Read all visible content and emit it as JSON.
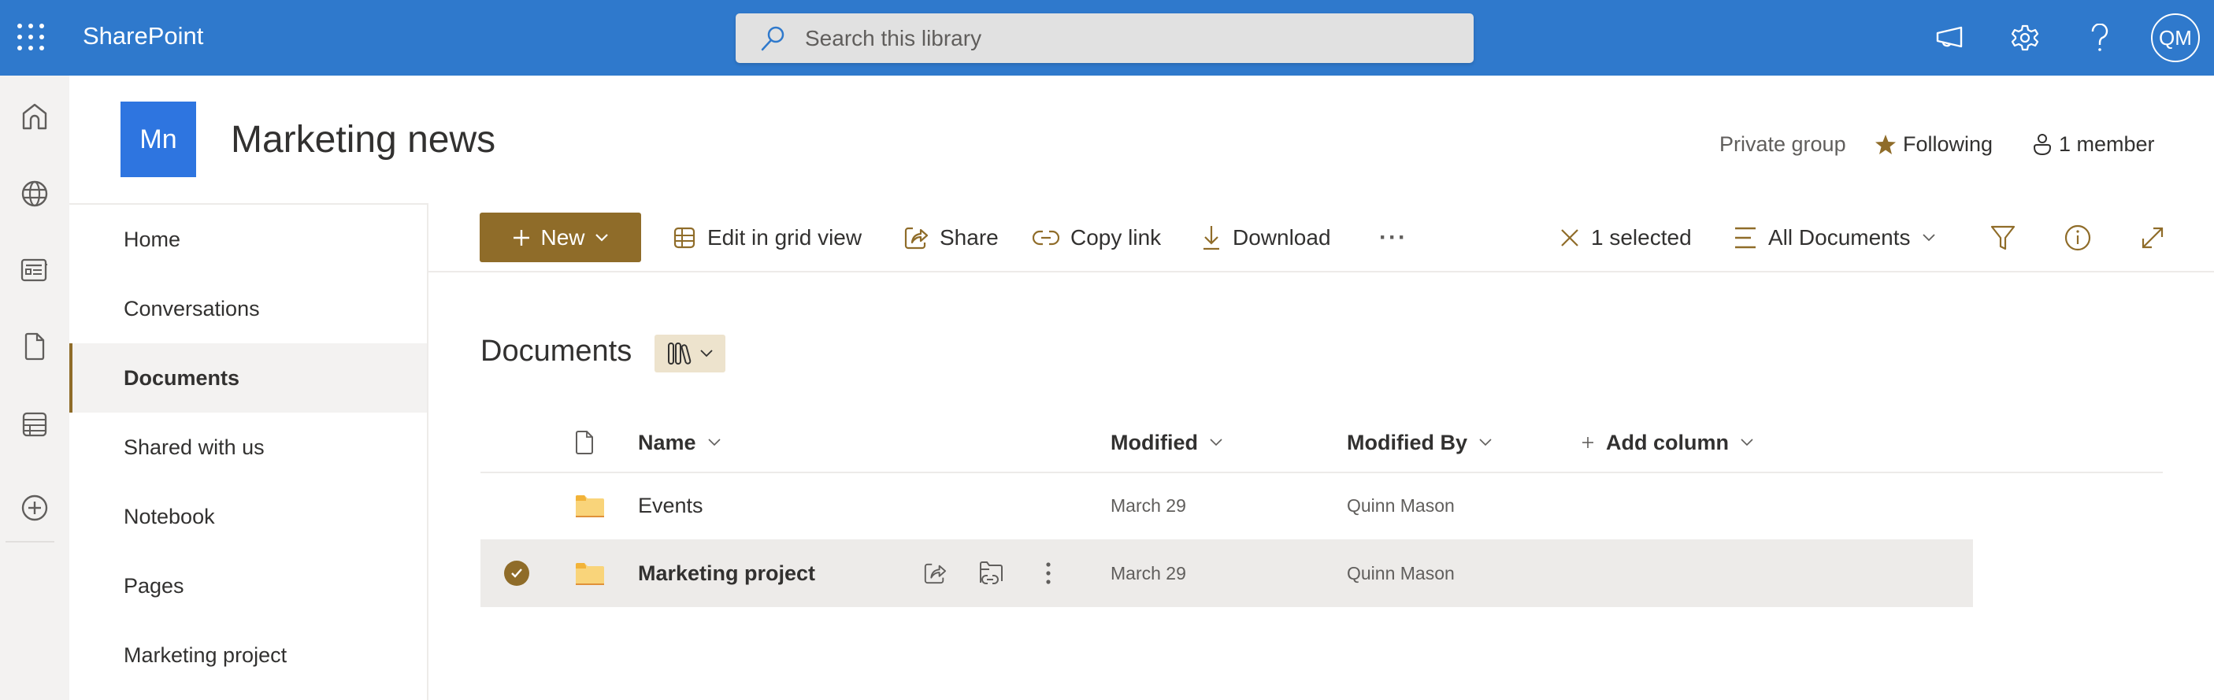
{
  "app": {
    "brand": "SharePoint",
    "search_placeholder": "Search this library",
    "user_initials": "QM",
    "colors": {
      "topbar": "#2F79CC",
      "accent": "#8F6C29",
      "site_logo": "#2E75E0"
    }
  },
  "header_icons": [
    "waffle-icon",
    "megaphone-icon",
    "gear-icon",
    "help-icon"
  ],
  "rail": {
    "items": [
      "home-icon",
      "globe-icon",
      "news-icon",
      "file-icon",
      "list-icon",
      "add-circle-icon"
    ]
  },
  "site": {
    "logo_initials": "Mn",
    "title": "Marketing news",
    "privacy": "Private group",
    "follow_label": "Following",
    "members_label": "1 member"
  },
  "nav": {
    "items": [
      {
        "label": "Home",
        "active": false
      },
      {
        "label": "Conversations",
        "active": false
      },
      {
        "label": "Documents",
        "active": true
      },
      {
        "label": "Shared with us",
        "active": false
      },
      {
        "label": "Notebook",
        "active": false
      },
      {
        "label": "Pages",
        "active": false
      },
      {
        "label": "Marketing project",
        "active": false
      }
    ]
  },
  "toolbar": {
    "new_label": "New",
    "edit_grid_label": "Edit in grid view",
    "share_label": "Share",
    "copy_link_label": "Copy link",
    "download_label": "Download",
    "more_label": "···",
    "selected_label": "1 selected",
    "view_label": "All Documents"
  },
  "library": {
    "title": "Documents",
    "columns": {
      "name": "Name",
      "modified": "Modified",
      "modified_by": "Modified By",
      "add_column": "Add column"
    },
    "rows": [
      {
        "name": "Events",
        "type": "folder",
        "modified": "March 29",
        "modified_by": "Quinn Mason",
        "selected": false
      },
      {
        "name": "Marketing project",
        "type": "folder",
        "modified": "March 29",
        "modified_by": "Quinn Mason",
        "selected": true
      }
    ]
  }
}
